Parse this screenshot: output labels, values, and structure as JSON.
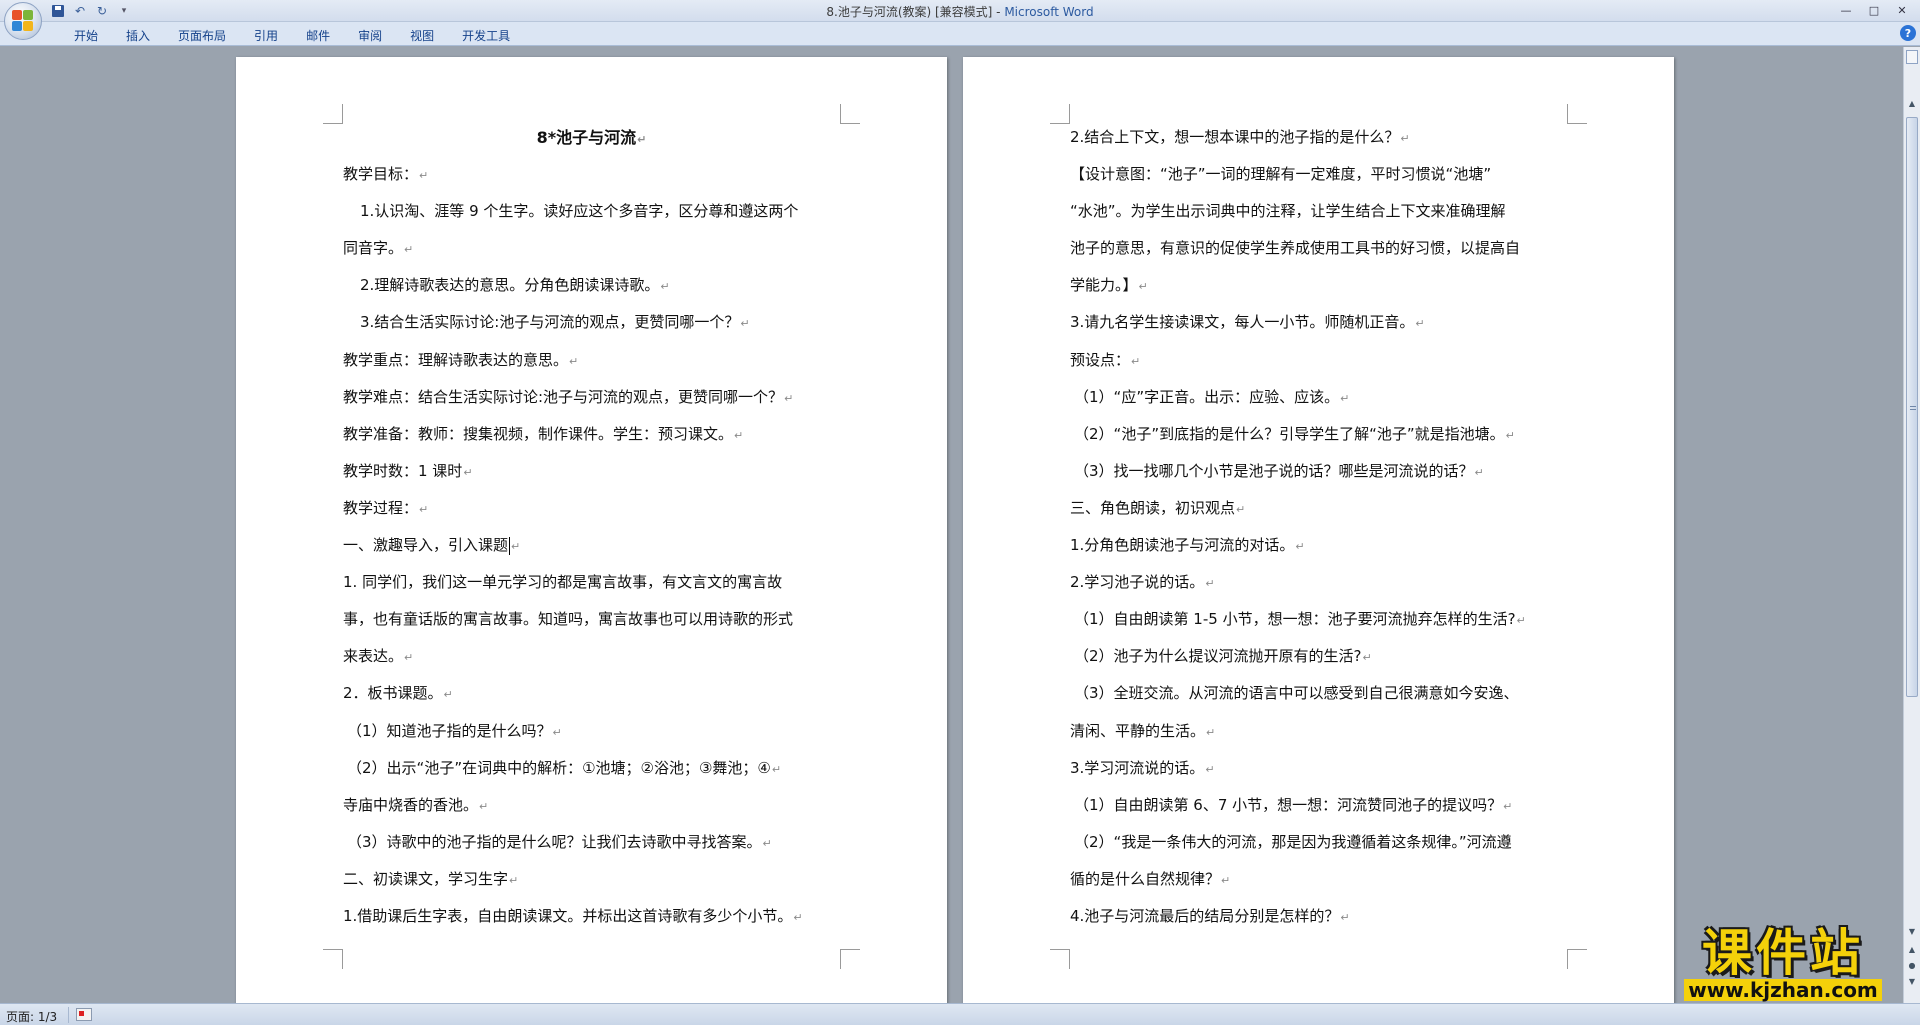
{
  "window": {
    "title": "8.池子与河流(教案) [兼容模式] - ",
    "app_name": "Microsoft Word",
    "minimize": "—",
    "maximize": "□",
    "close": "✕"
  },
  "quick_access": {
    "dropdown": "▾"
  },
  "ribbon": {
    "tabs": [
      "开始",
      "插入",
      "页面布局",
      "引用",
      "邮件",
      "审阅",
      "视图",
      "开发工具"
    ],
    "help": "?"
  },
  "document": {
    "page1_lines": [
      "8*池子与河流",
      "教学目标：",
      "1.认识淘、涯等 9 个生字。读好应这个多音字，区分尊和遵这两个",
      "同音字。",
      "2.理解诗歌表达的意思。分角色朗读课诗歌。",
      "3.结合生活实际讨论:池子与河流的观点，更赞同哪一个？",
      "教学重点：理解诗歌表达的意思。",
      "教学难点：结合生活实际讨论:池子与河流的观点，更赞同哪一个？",
      "教学准备：教师：搜集视频，制作课件。学生：预习课文。",
      "教学时数：1 课时",
      "教学过程：",
      "一、激趣导入，引入课题",
      "1.   同学们，我们这一单元学习的都是寓言故事，有文言文的寓言故",
      "事，也有童话版的寓言故事。知道吗，寓言故事也可以用诗歌的形式",
      "来表达。",
      "2．板书课题。",
      "（1）知道池子指的是什么吗？",
      "（2）出示“池子”在词典中的解析：①池塘；②浴池；③舞池；④",
      "寺庙中烧香的香池。",
      "（3）诗歌中的池子指的是什么呢？让我们去诗歌中寻找答案。",
      "二、初读课文，学习生字",
      "1.借助课后生字表，自由朗读课文。并标出这首诗歌有多少个小节。"
    ],
    "page2_lines": [
      "2.结合上下文，想一想本课中的池子指的是什么？",
      "【设计意图：“池子”一词的理解有一定难度，平时习惯说“池塘”",
      "“水池”。为学生出示词典中的注释，让学生结合上下文来准确理解",
      "池子的意思，有意识的促使学生养成使用工具书的好习惯，以提高自",
      "学能力。】",
      "3.请九名学生接读课文，每人一小节。师随机正音。",
      "预设点：",
      "（1）“应”字正音。出示：应验、应该。",
      "（2）“池子”到底指的是什么？引导学生了解“池子”就是指池塘。",
      "（3）找一找哪几个小节是池子说的话？哪些是河流说的话？",
      "三、角色朗读，初识观点",
      "1.分角色朗读池子与河流的对话。",
      "2.学习池子说的话。",
      "（1）自由朗读第 1-5 小节，想一想：池子要河流抛弃怎样的生活?",
      "（2）池子为什么提议河流抛开原有的生活?",
      "（3）全班交流。从河流的语言中可以感受到自己很满意如今安逸、",
      "清闲、平静的生活。",
      "3.学习河流说的话。",
      "（1）自由朗读第 6、7 小节，想一想：河流赞同池子的提议吗？",
      "（2）“我是一条伟大的河流，那是因为我遵循着这条规律。”河流遵",
      "循的是什么自然规律？",
      "4.池子与河流最后的结局分别是怎样的？"
    ]
  },
  "status_bar": {
    "page_info": "页面: 1/3"
  },
  "watermark": {
    "title": "课件站",
    "url": "www.kjzhan.com"
  }
}
